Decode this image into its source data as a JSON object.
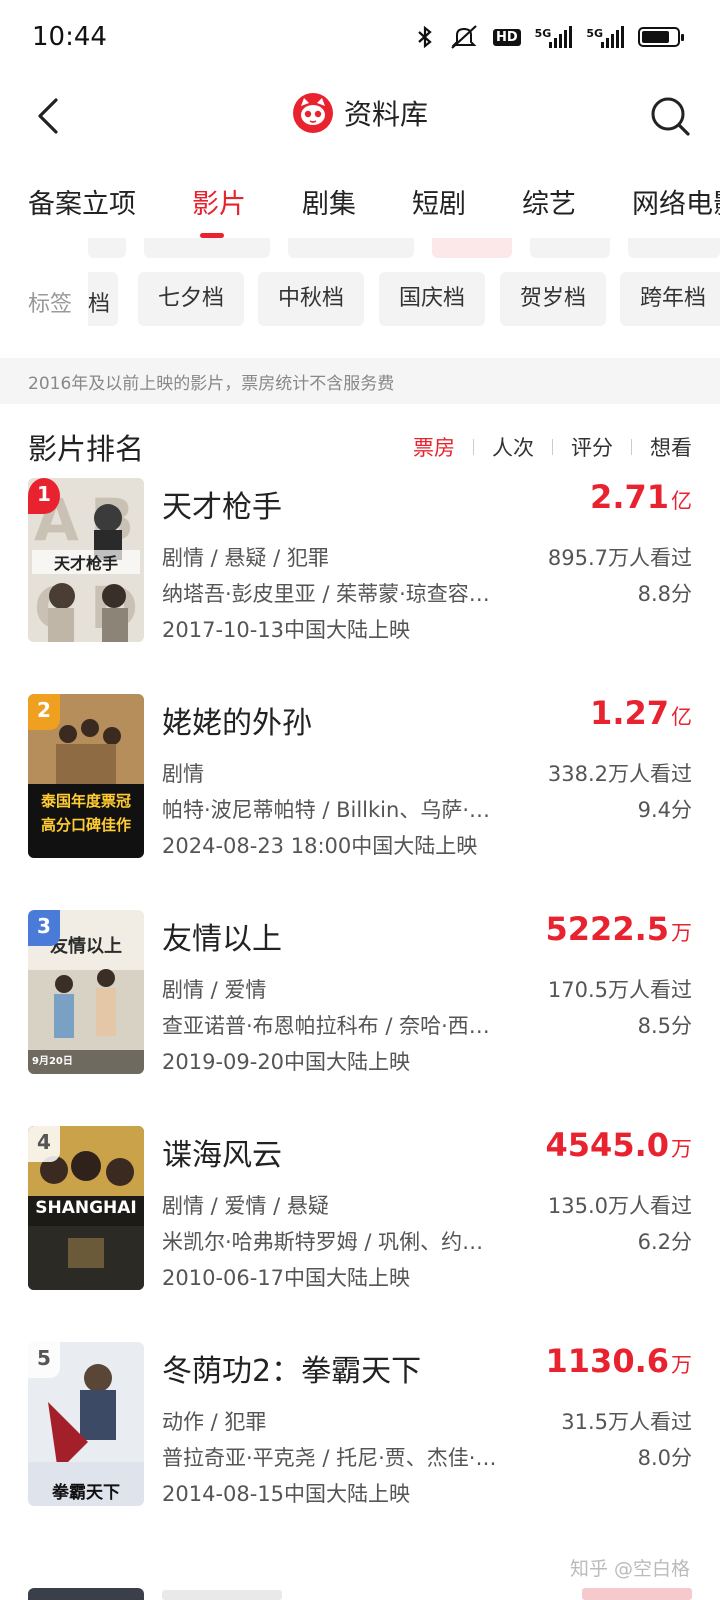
{
  "status_bar": {
    "time": "10:44",
    "network_a": "5G",
    "network_b": "5G",
    "hd": "HD",
    "battery_level": 0.8,
    "icons": [
      "bluetooth-icon",
      "mute-icon",
      "hd-icon",
      "signal-icon",
      "signal-icon",
      "battery-icon"
    ]
  },
  "nav": {
    "title": "资料库",
    "icons": [
      "back-icon",
      "maoyan-logo-icon",
      "search-icon"
    ],
    "brand_color": "#e8232f"
  },
  "tabs": [
    {
      "label": "备案立项",
      "active": false
    },
    {
      "label": "影片",
      "active": true
    },
    {
      "label": "剧集",
      "active": false
    },
    {
      "label": "短剧",
      "active": false
    },
    {
      "label": "综艺",
      "active": false
    },
    {
      "label": "网络电影",
      "active": false
    }
  ],
  "tag_filter": {
    "label": "标签",
    "partial_chip": "档",
    "chips": [
      "七夕档",
      "中秋档",
      "国庆档",
      "贺岁档",
      "跨年档"
    ]
  },
  "notice": "2016年及以前上映的影片，票房统计不含服务费",
  "section": {
    "title": "影片排名",
    "sort_options": [
      {
        "label": "票房",
        "active": true
      },
      {
        "label": "人次",
        "active": false
      },
      {
        "label": "评分",
        "active": false
      },
      {
        "label": "想看",
        "active": false
      }
    ]
  },
  "movies": [
    {
      "rank": "1",
      "title": "天才枪手",
      "box_value": "2.71",
      "box_unit": "亿",
      "genre": "剧情 / 悬疑 / 犯罪",
      "viewers": "895.7万人看过",
      "cast": "纳塔吾·彭皮里亚 / 茱蒂蒙·琼查容…",
      "score": "8.8分",
      "release": "2017-10-13中国大陆上映"
    },
    {
      "rank": "2",
      "title": "姥姥的外孙",
      "box_value": "1.27",
      "box_unit": "亿",
      "genre": "剧情",
      "viewers": "338.2万人看过",
      "cast": "帕特·波尼蒂帕特 / Billkin、乌萨·…",
      "score": "9.4分",
      "release": "2024-08-23 18:00中国大陆上映"
    },
    {
      "rank": "3",
      "title": "友情以上",
      "box_value": "5222.5",
      "box_unit": "万",
      "genre": "剧情 / 爱情",
      "viewers": "170.5万人看过",
      "cast": "查亚诺普·布恩帕拉科布 / 奈哈·西…",
      "score": "8.5分",
      "release": "2019-09-20中国大陆上映"
    },
    {
      "rank": "4",
      "title": "谍海风云",
      "box_value": "4545.0",
      "box_unit": "万",
      "genre": "剧情 / 爱情 / 悬疑",
      "viewers": "135.0万人看过",
      "cast": "米凯尔·哈弗斯特罗姆 / 巩俐、约…",
      "score": "6.2分",
      "release": "2010-06-17中国大陆上映"
    },
    {
      "rank": "5",
      "title": "冬荫功2：拳霸天下",
      "box_value": "1130.6",
      "box_unit": "万",
      "genre": "动作 / 犯罪",
      "viewers": "31.5万人看过",
      "cast": "普拉奇亚·平克尧 / 托尼·贾、杰佳·…",
      "score": "8.0分",
      "release": "2014-08-15中国大陆上映"
    }
  ],
  "posters": {
    "p1_text": "天才枪手",
    "p2_text_a": "泰国年度票冠",
    "p2_text_b": "高分口碑佳作",
    "p3_text": "友情以上",
    "p3_date": "9月20日",
    "p4_text": "SHANGHAI",
    "p5_text": "拳霸天下"
  },
  "watermark": "知乎 @空白格"
}
